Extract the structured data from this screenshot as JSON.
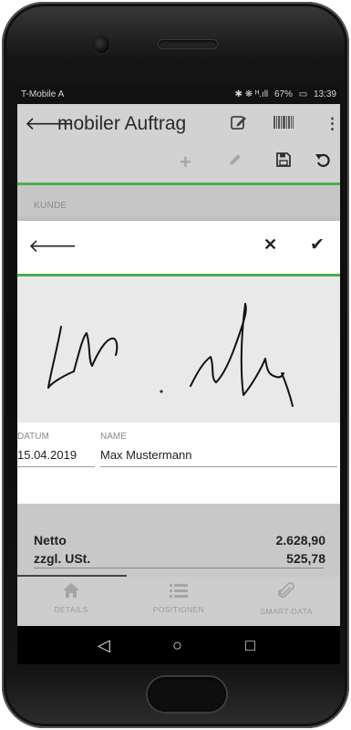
{
  "status_bar": {
    "carrier": "T-Mobile A",
    "indicators": "✱ ❋ ᴴ.ıll",
    "battery": "67%",
    "time": "13:39"
  },
  "app_bar": {
    "title": "mobiler Auftrag",
    "icons": [
      "back-arrow-icon",
      "edit-icon",
      "barcode-icon",
      "more-vert-icon"
    ]
  },
  "toolbar": {
    "icons": [
      "add-icon",
      "pencil-icon",
      "save-icon",
      "undo-icon"
    ]
  },
  "background_section": {
    "label": "KUNDE"
  },
  "signature_dialog": {
    "icons": [
      "back-arrow-icon",
      "close-icon",
      "check-icon"
    ],
    "fields": {
      "date_label": "DATUM",
      "date_value": "15.04.2019",
      "name_label": "NAME",
      "name_value": "Max Mustermann"
    }
  },
  "totals": {
    "net_label": "Netto",
    "net_value": "2.628,90",
    "vat_label": "zzgl. USt.",
    "vat_value": "525,78"
  },
  "bottom_tabs": [
    {
      "label": "DETAILS",
      "icon": "home-icon"
    },
    {
      "label": "POSITIONEN",
      "icon": "list-icon"
    },
    {
      "label": "SMART-DATA",
      "icon": "paperclip-icon"
    }
  ],
  "nav_bar": {
    "icons": [
      "nav-back-icon",
      "nav-home-icon",
      "nav-recents-icon"
    ]
  },
  "colors": {
    "accent": "#4caf50",
    "app_bar": "#d2d2d2",
    "dialog_bg": "#ffffff",
    "signature_pad_bg": "#e9e9e9"
  }
}
